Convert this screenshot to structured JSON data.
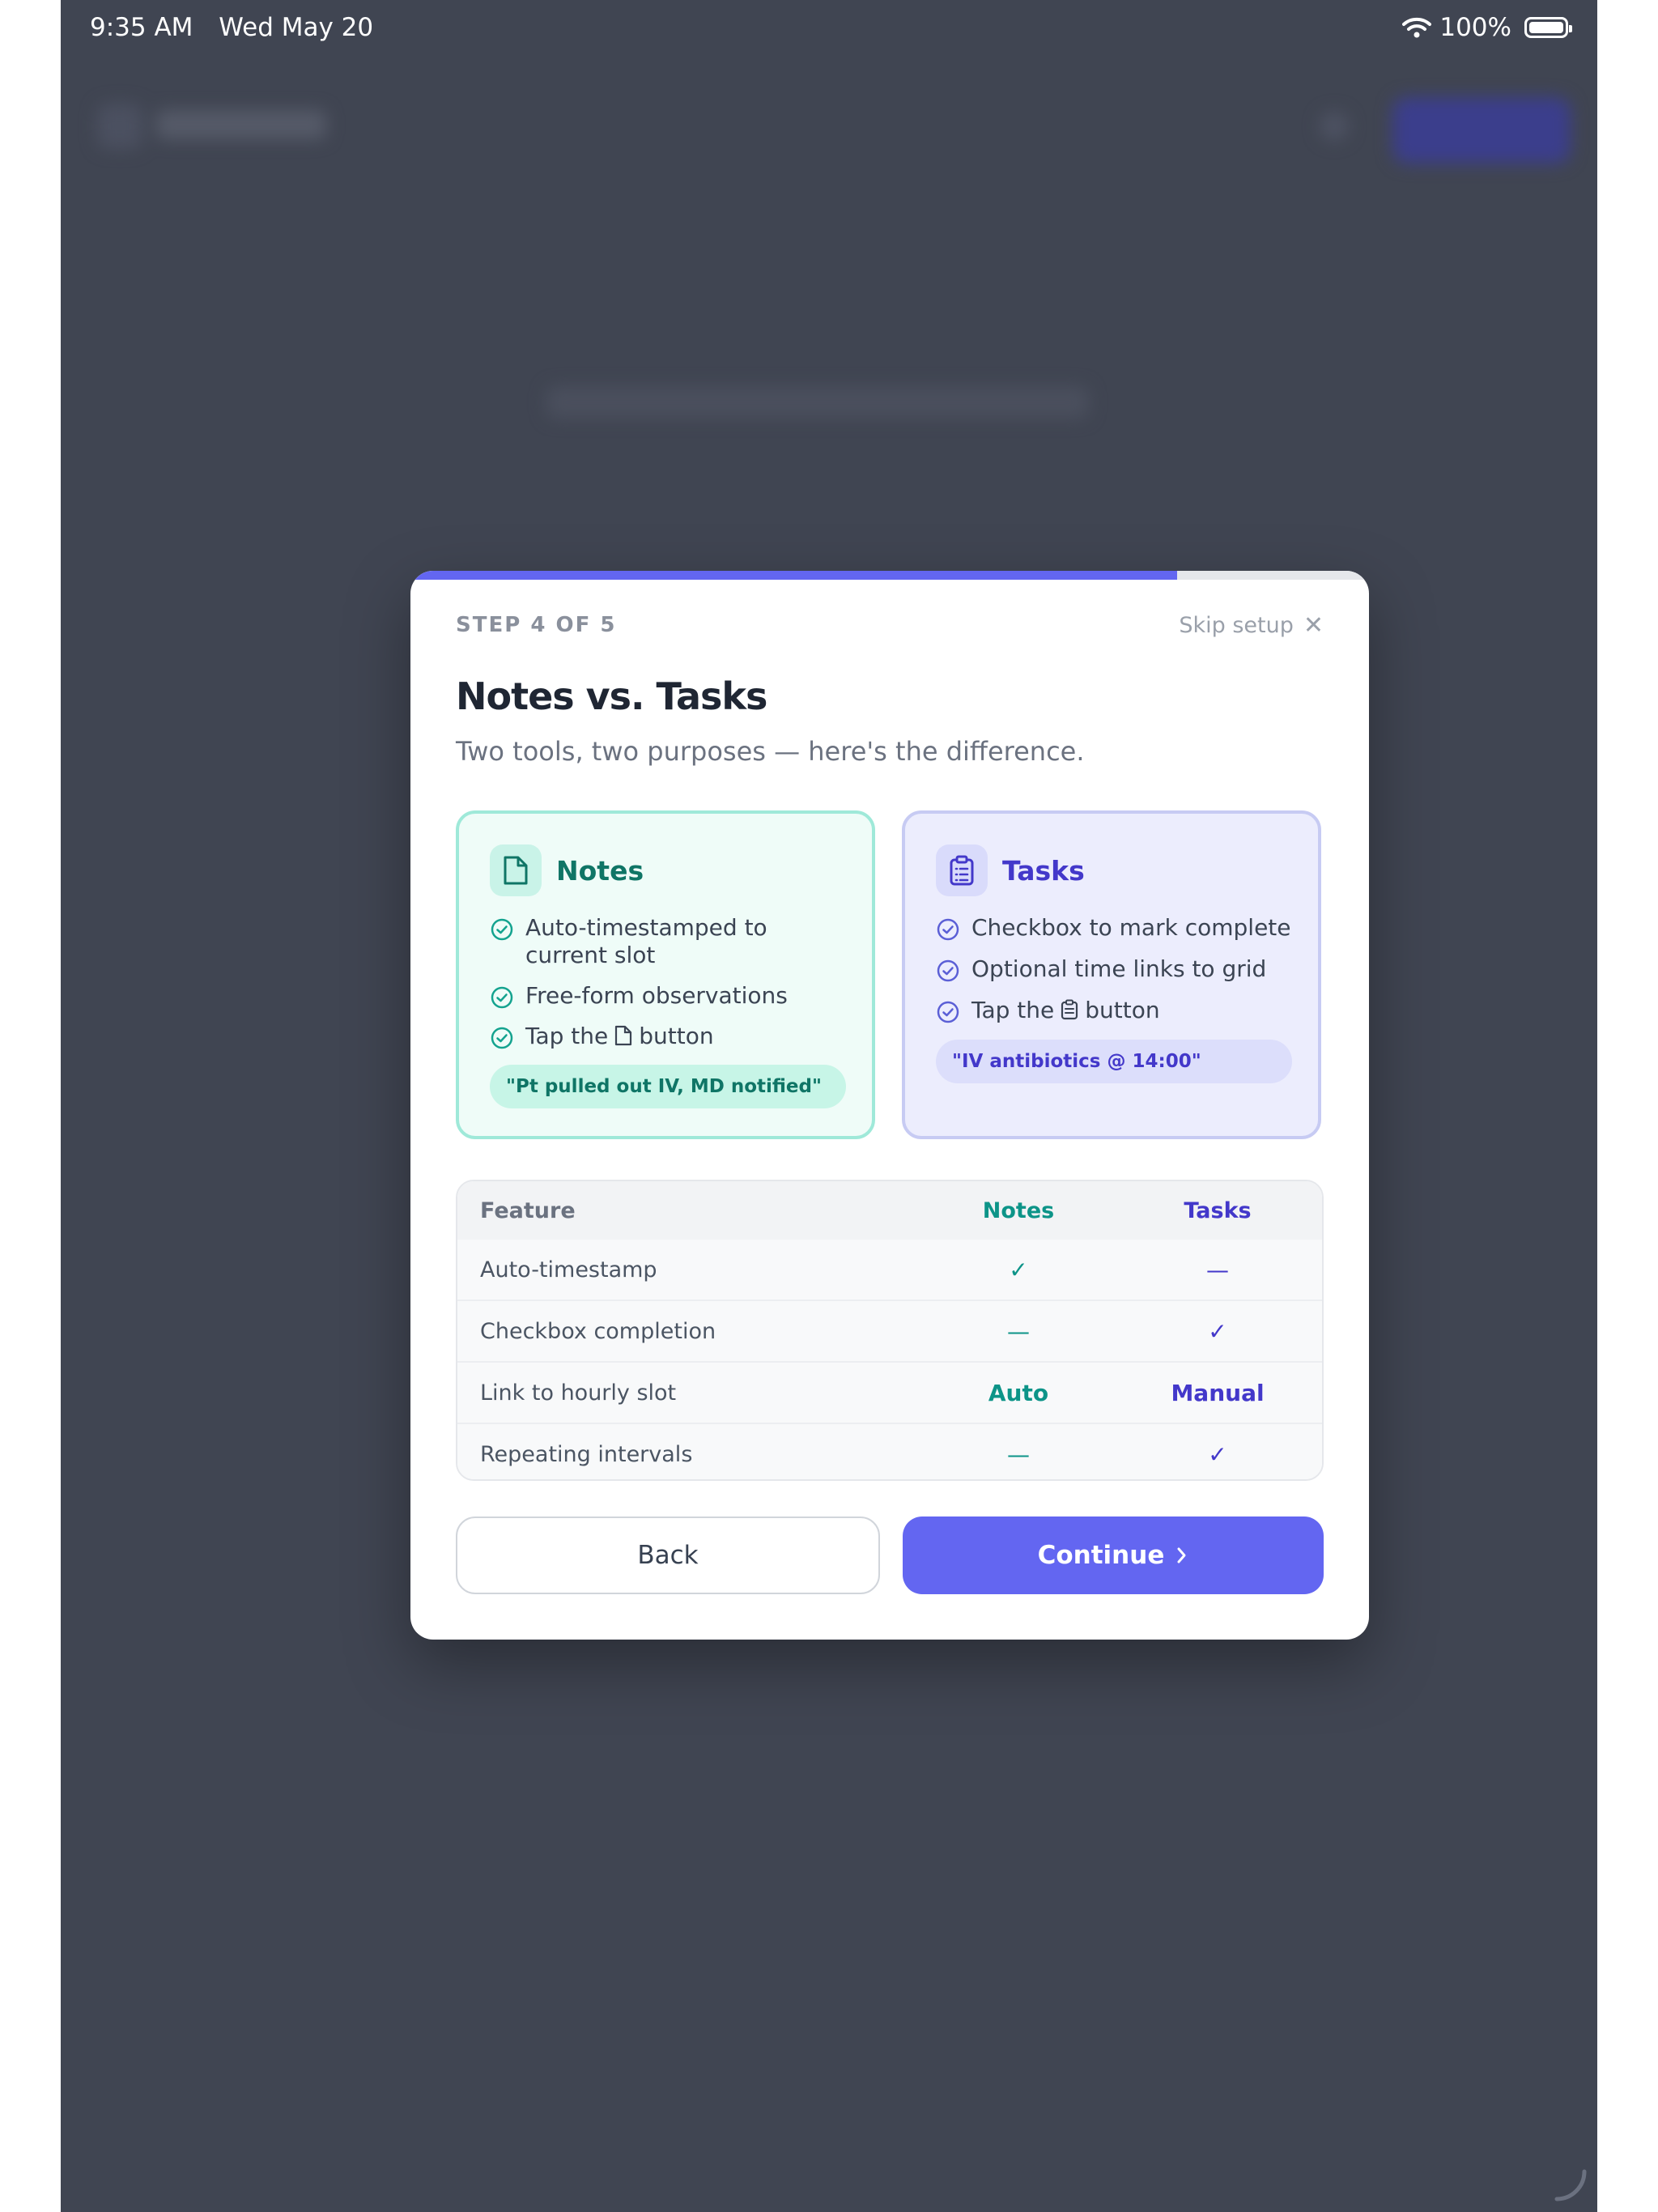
{
  "status_bar": {
    "time": "9:35 AM",
    "date": "Wed May 20",
    "battery": "100%",
    "icons": [
      "wifi-icon",
      "battery-icon"
    ]
  },
  "modal": {
    "progress_fraction": 0.8,
    "step_label": "STEP 4 OF 5",
    "skip_label": "Skip setup",
    "title": "Notes vs. Tasks",
    "subtitle": "Two tools, two purposes — here's the difference.",
    "notes_card": {
      "title": "Notes",
      "icon": "note-icon",
      "bullets": [
        "Auto-timestamped to current slot",
        "Free-form observations"
      ],
      "tap_prefix": "Tap the",
      "tap_suffix": "button",
      "example": "\"Pt pulled out IV, MD notified\""
    },
    "tasks_card": {
      "title": "Tasks",
      "icon": "clipboard-icon",
      "bullets": [
        "Checkbox to mark complete",
        "Optional time links to grid"
      ],
      "tap_prefix": "Tap the",
      "tap_suffix": "button",
      "example": "\"IV antibiotics @ 14:00\""
    },
    "table": {
      "headers": [
        "Feature",
        "Notes",
        "Tasks"
      ],
      "rows": [
        [
          "Auto-timestamp",
          "✓",
          "—"
        ],
        [
          "Checkbox completion",
          "—",
          "✓"
        ],
        [
          "Link to hourly slot",
          "Auto",
          "Manual"
        ],
        [
          "Repeating intervals",
          "—",
          "✓"
        ]
      ]
    },
    "back_label": "Back",
    "continue_label": "Continue"
  },
  "colors": {
    "accent": "#6366f1",
    "notes": "#0d9488",
    "tasks": "#4338ca",
    "backdrop": "#404552"
  }
}
